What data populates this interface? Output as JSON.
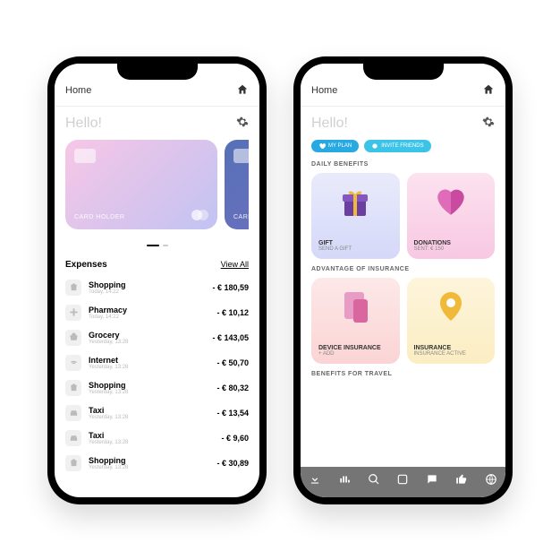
{
  "phone1": {
    "nav": {
      "title": "Home"
    },
    "greeting": "Hello!",
    "card": {
      "holder": "CARD HOLDER"
    },
    "expenses": {
      "title": "Expenses",
      "viewall": "View All",
      "items": [
        {
          "name": "Shopping",
          "date": "Today, 14:22",
          "amount": "- € 180,59"
        },
        {
          "name": "Pharmacy",
          "date": "Today, 14:22",
          "amount": "- € 10,12"
        },
        {
          "name": "Grocery",
          "date": "Yesterday, 13:28",
          "amount": "- € 143,05"
        },
        {
          "name": "Internet",
          "date": "Yesterday, 13:28",
          "amount": "- € 50,70"
        },
        {
          "name": "Shopping",
          "date": "Yesterday, 13:28",
          "amount": "- € 80,32"
        },
        {
          "name": "Taxi",
          "date": "Yesterday, 13:28",
          "amount": "- € 13,54"
        },
        {
          "name": "Taxi",
          "date": "Yesterday, 13:28",
          "amount": "- € 9,60"
        },
        {
          "name": "Shopping",
          "date": "Yesterday, 13:28",
          "amount": "- € 30,89"
        }
      ]
    }
  },
  "phone2": {
    "nav": {
      "title": "Home"
    },
    "greeting": "Hello!",
    "pills": {
      "plan": "MY PLAN",
      "invite": "INVITE FRIENDS"
    },
    "sections": {
      "daily": "DAILY BENEFITS",
      "insurance": "ADVANTAGE OF INSURANCE",
      "travel": "BENEFITS FOR TRAVEL"
    },
    "tiles": {
      "gift": {
        "title": "GIFT",
        "sub": "SEND A GIFT"
      },
      "donations": {
        "title": "DONATIONS",
        "sub": "SENT: € 150"
      },
      "device": {
        "title": "DEVICE INSURANCE",
        "sub": "+ ADD"
      },
      "ins": {
        "title": "INSURANCE",
        "sub": "INSURANCE ACTIVE"
      }
    }
  }
}
